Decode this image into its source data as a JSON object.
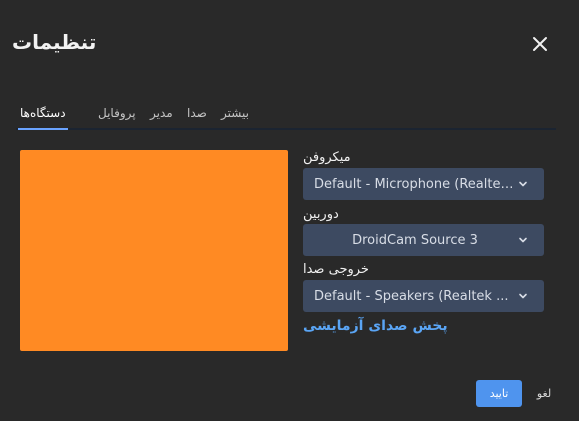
{
  "dialog": {
    "title": "تنظیمات",
    "close_icon": "close-icon"
  },
  "tabs": [
    {
      "label": "دستگاه‌ها",
      "active": true
    },
    {
      "label": "پروفایل",
      "active": false
    },
    {
      "label": "مدیر",
      "active": false
    },
    {
      "label": "صدا",
      "active": false
    },
    {
      "label": "بیشتر",
      "active": false
    }
  ],
  "preview": {
    "color": "#ff8a23"
  },
  "devices": {
    "microphone_label": "میکروفن",
    "microphone_value": "Default - Microphone (Realtek...",
    "camera_label": "دوربین",
    "camera_value": "DroidCam Source 3",
    "speaker_label": "خروجی صدا",
    "speaker_value": "Default - Speakers (Realtek ...",
    "test_sound_link": "پخش صدای آزمایشی",
    "chevron_icon": "chevron-down-icon"
  },
  "footer": {
    "confirm_label": "تایید",
    "cancel_label": "لغو"
  },
  "colors": {
    "background": "#292929",
    "select_bg": "#3d4a61",
    "accent": "#4f94ee",
    "link": "#5aa5f5"
  }
}
